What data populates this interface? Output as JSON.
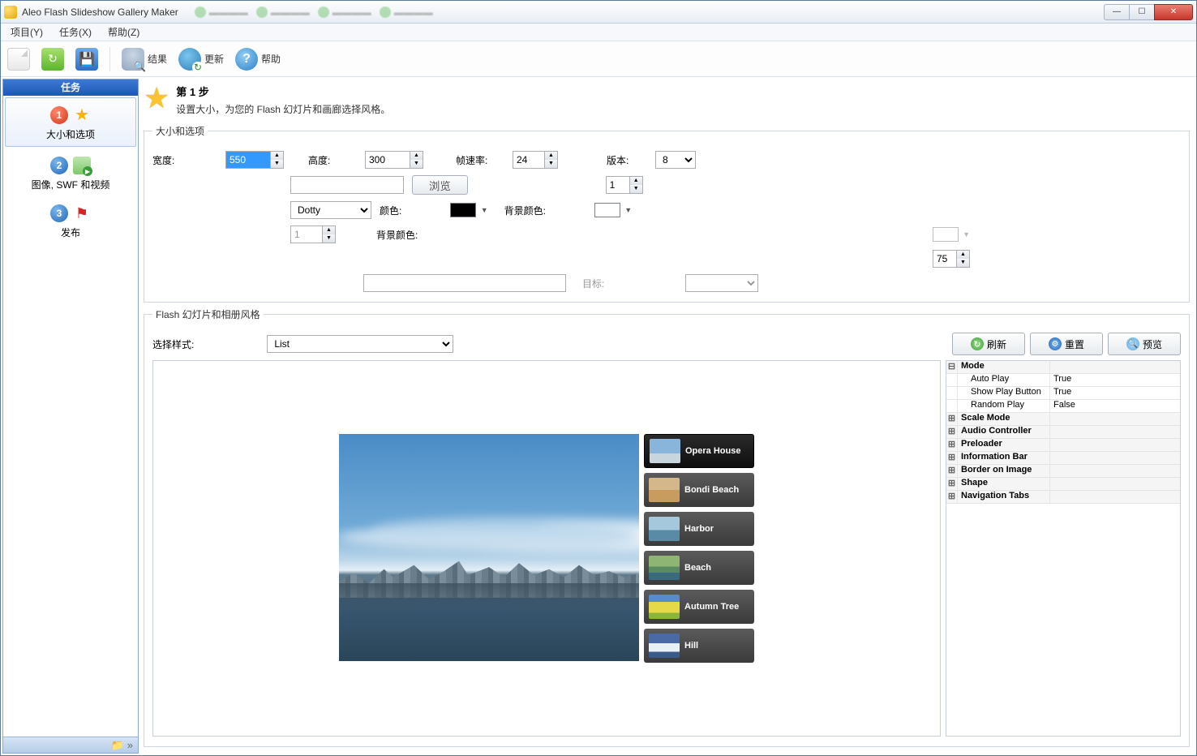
{
  "titlebar": {
    "title": "Aleo Flash Slideshow Gallery Maker"
  },
  "menubar": {
    "project": "项目(Y)",
    "task": "任务(X)",
    "help": "帮助(Z)"
  },
  "toolbar": {
    "result": "结果",
    "update": "更新",
    "help": "帮助"
  },
  "sidebar": {
    "header": "任务",
    "items": [
      {
        "label": "大小和选项"
      },
      {
        "label": "图像, SWF 和视频"
      },
      {
        "label": "发布"
      }
    ]
  },
  "step": {
    "title": "第 1 步",
    "desc": "设置大小，为您的 Flash 幻灯片和画廊选择风格。"
  },
  "size_group": {
    "legend": "大小和选项",
    "width_label": "宽度:",
    "width_value": "550",
    "height_label": "高度:",
    "height_value": "300",
    "fps_label": "帧速率:",
    "fps_value": "24",
    "version_label": "版本:",
    "version_value": "8",
    "browse_label": "浏览",
    "num1_value": "1",
    "dotty_value": "Dotty",
    "color_label": "颜色:",
    "bgcolor_label": "背景颜色:",
    "num2_value": "1",
    "bgcolor2_label": "背景颜色:",
    "num75_value": "75",
    "target_label": "目标:"
  },
  "style_group": {
    "legend": "Flash 幻灯片和相册风格",
    "select_label": "选择样式:",
    "select_value": "List",
    "refresh": "刷新",
    "reset": "重置",
    "preview": "预览"
  },
  "slides": [
    {
      "label": "Opera House"
    },
    {
      "label": "Bondi Beach"
    },
    {
      "label": "Harbor"
    },
    {
      "label": "Beach"
    },
    {
      "label": "Autumn Tree"
    },
    {
      "label": "Hill"
    }
  ],
  "props": {
    "mode": "Mode",
    "autoplay_k": "Auto Play",
    "autoplay_v": "True",
    "showplay_k": "Show Play Button",
    "showplay_v": "True",
    "random_k": "Random Play",
    "random_v": "False",
    "scale": "Scale Mode",
    "audio": "Audio Controller",
    "preloader": "Preloader",
    "infobar": "Information Bar",
    "border": "Border on Image",
    "shape": "Shape",
    "navtabs": "Navigation Tabs"
  }
}
